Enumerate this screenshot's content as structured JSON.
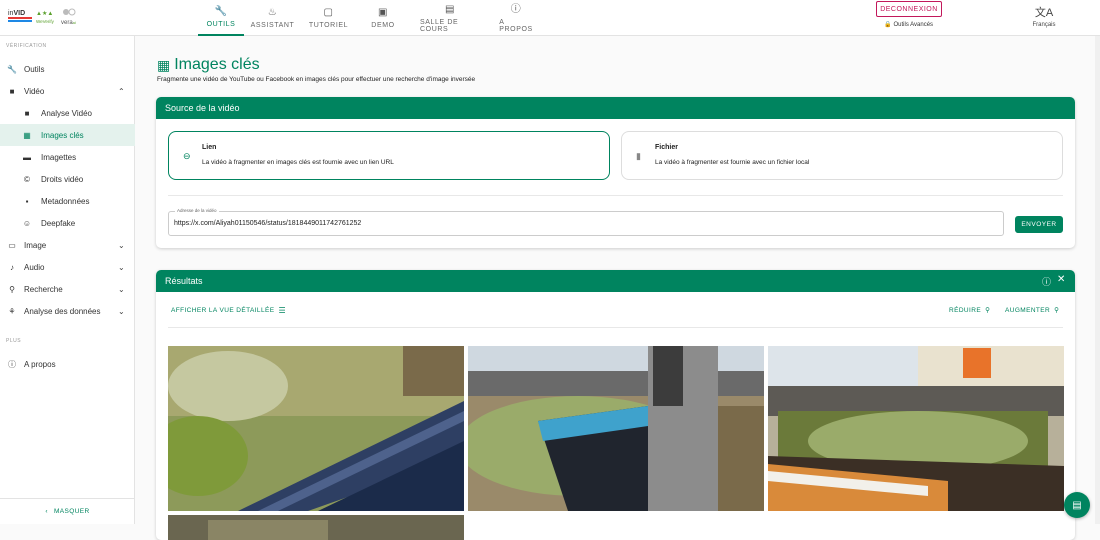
{
  "topbar": {
    "logo_text": "InVID WeVerify vera.ai",
    "nav": [
      {
        "label": "OUTILS",
        "icon": "wrench-icon"
      },
      {
        "label": "ASSISTANT",
        "icon": "assistant-icon"
      },
      {
        "label": "TUTORIEL",
        "icon": "book-icon"
      },
      {
        "label": "DEMO",
        "icon": "demo-icon"
      },
      {
        "label": "SALLE DE COURS",
        "icon": "classroom-icon"
      },
      {
        "label": "A PROPOS",
        "icon": "info-icon"
      }
    ],
    "logout_label": "DECONNEXION",
    "advanced_label": "Outils Avancés",
    "language_label": "Français"
  },
  "sidebar": {
    "section_verification": "VÉRIFICATION",
    "items": [
      {
        "label": "Outils",
        "icon": "wrench-icon"
      },
      {
        "label": "Vidéo",
        "icon": "video-icon"
      },
      {
        "label": "Analyse Vidéo",
        "icon": "video-analysis-icon"
      },
      {
        "label": "Images clés",
        "icon": "keyframes-icon"
      },
      {
        "label": "Imagettes",
        "icon": "thumbnails-icon"
      },
      {
        "label": "Droits vidéo",
        "icon": "copyright-icon"
      },
      {
        "label": "Metadonnées",
        "icon": "metadata-icon"
      },
      {
        "label": "Deepfake",
        "icon": "deepfake-icon"
      },
      {
        "label": "Image",
        "icon": "image-icon"
      },
      {
        "label": "Audio",
        "icon": "audio-icon"
      },
      {
        "label": "Recherche",
        "icon": "search-icon"
      },
      {
        "label": "Analyse des données",
        "icon": "data-icon"
      }
    ],
    "section_more": "PLUS",
    "about_label": "A propos",
    "hide_label": "MASQUER"
  },
  "page": {
    "title": "Images clés",
    "subtitle": "Fragmente une vidéo de YouTube ou Facebook en images clés pour effectuer une recherche d'image inversée"
  },
  "source_card": {
    "header": "Source de la vidéo",
    "option_link_title": "Lien",
    "option_link_desc": "La vidéo à fragmenter en images clés est fournie avec un lien URL",
    "option_file_title": "Fichier",
    "option_file_desc": "La vidéo à fragmenter est fournie avec un fichier local",
    "url_label": "Adresse de la vidéo",
    "url_value": "https://x.com/Aliyah01150546/status/1818449011742761252",
    "send_label": "ENVOYER"
  },
  "results_card": {
    "header": "Résultats",
    "detailed_view_label": "AFFICHER LA VUE DÉTAILLÉE",
    "reduce_label": "RÉDUIRE",
    "enlarge_label": "AUGMENTER"
  },
  "colors": {
    "accent": "#00845f",
    "logout": "#c2185b"
  }
}
